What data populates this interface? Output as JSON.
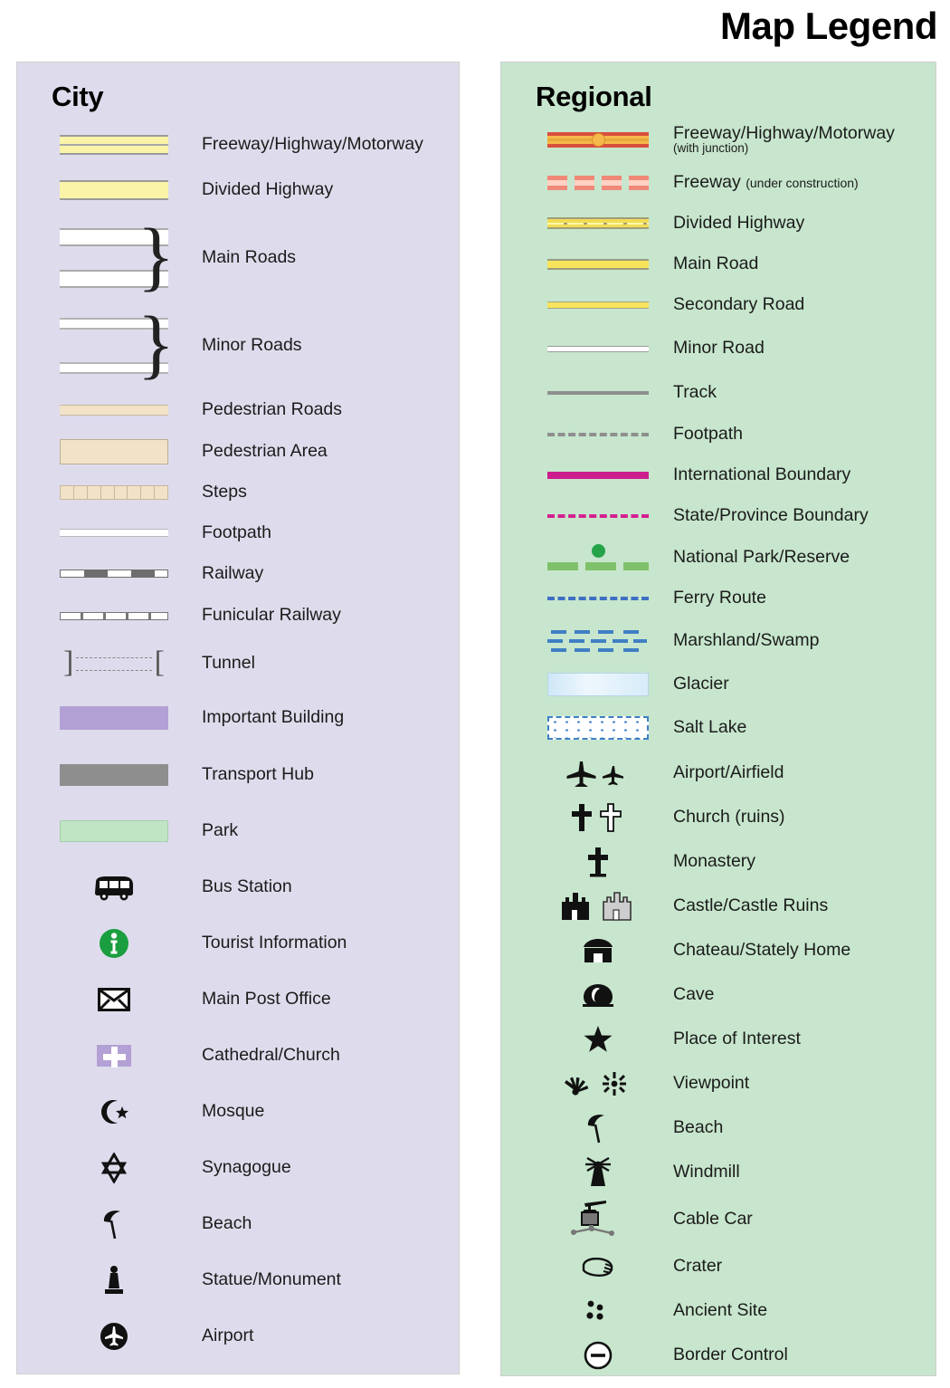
{
  "title": "Map Legend",
  "city": {
    "heading": "City",
    "bg": "#dedcec",
    "items": [
      {
        "symbol": "freeway-band",
        "label": "Freeway/Highway/Motorway"
      },
      {
        "symbol": "divided-highway-band",
        "label": "Divided Highway"
      },
      {
        "symbol": "main-roads-group",
        "label": "Main Roads"
      },
      {
        "symbol": "minor-roads-group",
        "label": "Minor Roads"
      },
      {
        "symbol": "pedestrian-road-band",
        "label": "Pedestrian Roads"
      },
      {
        "symbol": "pedestrian-area-swatch",
        "label": "Pedestrian Area"
      },
      {
        "symbol": "steps-band",
        "label": "Steps"
      },
      {
        "symbol": "footpath-band",
        "label": "Footpath"
      },
      {
        "symbol": "railway-band",
        "label": "Railway"
      },
      {
        "symbol": "funicular-band",
        "label": "Funicular Railway"
      },
      {
        "symbol": "tunnel-brackets",
        "label": "Tunnel"
      },
      {
        "symbol": "important-building-swatch",
        "label": "Important Building"
      },
      {
        "symbol": "transport-hub-swatch",
        "label": "Transport Hub"
      },
      {
        "symbol": "park-swatch",
        "label": "Park"
      },
      {
        "symbol": "bus-icon",
        "label": "Bus Station"
      },
      {
        "symbol": "information-icon",
        "label": "Tourist Information"
      },
      {
        "symbol": "envelope-icon",
        "label": "Main Post Office"
      },
      {
        "symbol": "church-cross-icon",
        "label": "Cathedral/Church"
      },
      {
        "symbol": "crescent-star-icon",
        "label": "Mosque"
      },
      {
        "symbol": "star-of-david-icon",
        "label": "Synagogue"
      },
      {
        "symbol": "beach-umbrella-icon",
        "label": "Beach"
      },
      {
        "symbol": "statue-icon",
        "label": "Statue/Monument"
      },
      {
        "symbol": "airplane-circle-icon",
        "label": "Airport"
      }
    ]
  },
  "regional": {
    "heading": "Regional",
    "bg": "#c7e6cd",
    "items": [
      {
        "symbol": "freeway-junction-line",
        "label": "Freeway/Highway/Motorway",
        "sub": "(with junction)"
      },
      {
        "symbol": "freeway-dashed-line",
        "label": "Freeway",
        "inline_sub": "(under construction)"
      },
      {
        "symbol": "divided-highway-line",
        "label": "Divided Highway"
      },
      {
        "symbol": "main-road-line",
        "label": "Main Road"
      },
      {
        "symbol": "secondary-road-line",
        "label": "Secondary Road"
      },
      {
        "symbol": "minor-road-line",
        "label": "Minor Road"
      },
      {
        "symbol": "track-line",
        "label": "Track"
      },
      {
        "symbol": "footpath-dashed-line",
        "label": "Footpath"
      },
      {
        "symbol": "international-boundary-line",
        "label": "International Boundary"
      },
      {
        "symbol": "state-boundary-line",
        "label": "State/Province Boundary"
      },
      {
        "symbol": "national-park-line",
        "label": "National Park/Reserve"
      },
      {
        "symbol": "ferry-route-line",
        "label": "Ferry Route"
      },
      {
        "symbol": "marshland-pattern",
        "label": "Marshland/Swamp"
      },
      {
        "symbol": "glacier-swatch",
        "label": "Glacier"
      },
      {
        "symbol": "salt-lake-swatch",
        "label": "Salt Lake"
      },
      {
        "symbol": "airplane-pair-icon",
        "label": "Airport/Airfield"
      },
      {
        "symbol": "cross-pair-icon",
        "label": "Church (ruins)"
      },
      {
        "symbol": "cross-icon",
        "label": "Monastery"
      },
      {
        "symbol": "castle-pair-icon",
        "label": "Castle/Castle Ruins"
      },
      {
        "symbol": "chateau-icon",
        "label": "Chateau/Stately Home"
      },
      {
        "symbol": "cave-icon",
        "label": "Cave"
      },
      {
        "symbol": "star-icon",
        "label": "Place of Interest"
      },
      {
        "symbol": "viewpoint-pair-icon",
        "label": "Viewpoint"
      },
      {
        "symbol": "beach-umbrella-icon",
        "label": "Beach"
      },
      {
        "symbol": "windmill-icon",
        "label": "Windmill"
      },
      {
        "symbol": "cable-car-icon",
        "label": "Cable Car"
      },
      {
        "symbol": "crater-icon",
        "label": "Crater"
      },
      {
        "symbol": "ancient-site-icon",
        "label": "Ancient Site"
      },
      {
        "symbol": "border-control-icon",
        "label": "Border Control"
      }
    ]
  },
  "colors": {
    "city_panel_bg": "#dedcec",
    "regional_panel_bg": "#c7e6cd",
    "city_highway_yellow": "#faf4a8",
    "pedestrian_tan": "#f1e2c8",
    "important_building_purple": "#b3a0d4",
    "transport_hub_gray": "#8e8e8e",
    "park_green": "#bfe5c4",
    "regional_freeway_red": "#d94f3d",
    "regional_freeway_orange": "#f5b84a",
    "regional_road_yellow": "#f7e35c",
    "boundary_magenta": "#cc1d8d",
    "ferry_blue": "#3f6fc4",
    "park_line_green": "#7fc06b",
    "tourist_info_green": "#1a9e3f"
  }
}
